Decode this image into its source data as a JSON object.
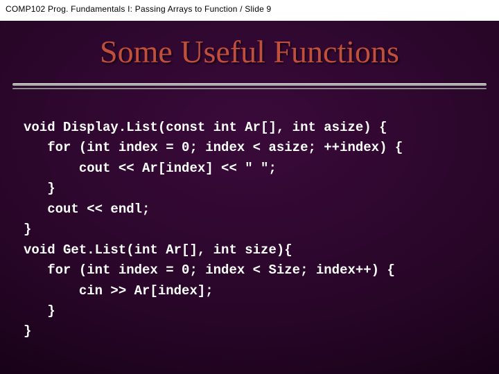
{
  "header": "COMP102  Prog. Fundamentals I: Passing Arrays to Function / Slide 9",
  "title": "Some Useful Functions",
  "code_lines": {
    "l0": "void Display.List(const int Ar[], int asize) {",
    "l1": "   for (int index = 0; index < asize; ++index) {",
    "l2": "       cout << Ar[index] << \" \";",
    "l3": "   }",
    "l4": "   cout << endl;",
    "l5": "}",
    "l6": "void Get.List(int Ar[], int size){",
    "l7": "   for (int index = 0; index < Size; index++) {",
    "l8": "       cin >> Ar[index];",
    "l9": "   }",
    "l10": "}"
  }
}
